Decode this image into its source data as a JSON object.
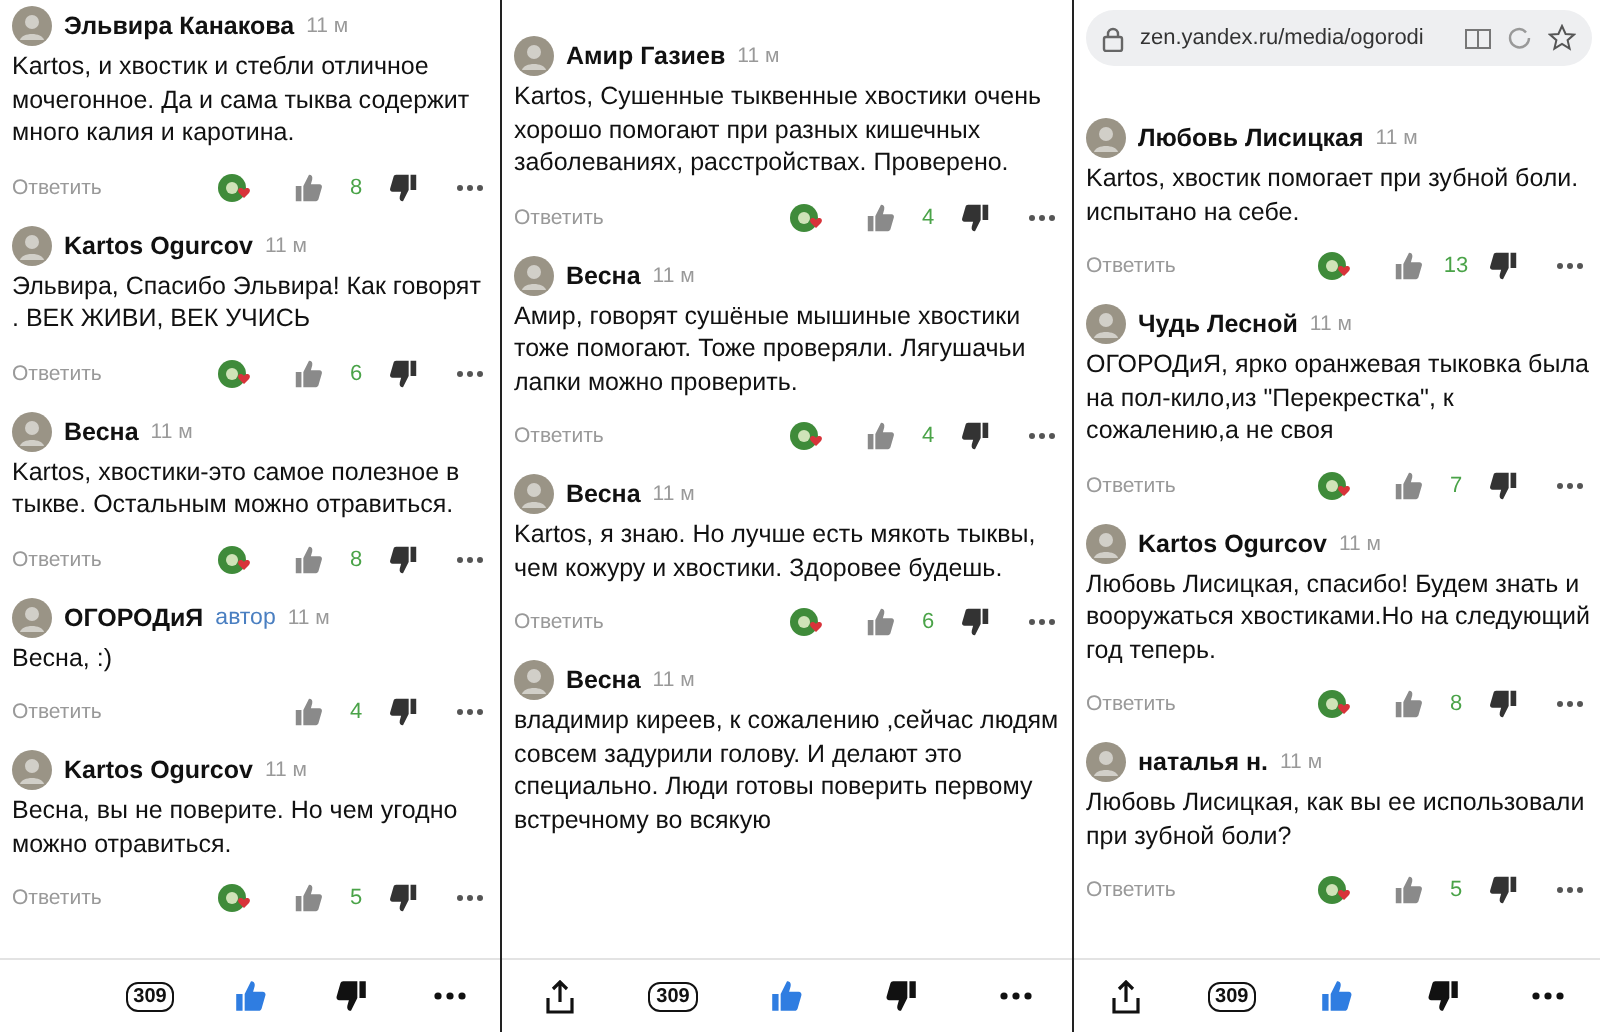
{
  "panels": [
    {
      "comments": [
        {
          "author": "Эльвира Канакова",
          "time": "11 м",
          "text": "Kartos, и хвостик и стебли отличное мочегонное. Да и сама тыква содержит много калия и каротина.",
          "reply": "Ответить",
          "author_liked": true,
          "likes": "8"
        },
        {
          "author": "Kartos Ogurcov",
          "time": "11 м",
          "text": "Эльвира, Спасибо Эльвира! Как говорят . ВЕК ЖИВИ, ВЕК УЧИСЬ",
          "reply": "Ответить",
          "author_liked": true,
          "likes": "6"
        },
        {
          "author": "Весна",
          "time": "11 м",
          "text": "Kartos, хвостики-это самое полезное в тыкве. Остальным можно отравиться.",
          "reply": "Ответить",
          "author_liked": true,
          "likes": "8"
        },
        {
          "author": "ОГОРОДиЯ",
          "badge": "автор",
          "time": "11 м",
          "text": "Весна, :)",
          "reply": "Ответить",
          "author_liked": false,
          "likes": "4"
        },
        {
          "author": "Kartos Ogurcov",
          "time": "11 м",
          "text": "Весна, вы не поверите. Но чем угодно можно отравиться.",
          "reply": "Ответить",
          "author_liked": true,
          "likes": "5"
        }
      ],
      "bottom_bar": {
        "share_button": false,
        "count": "309",
        "liked": true
      }
    },
    {
      "comments": [
        {
          "author": "Амир Газиев",
          "time": "11 м",
          "text": "Kartos, Сушенные тыквенные хвостики очень хорошо помогают при разных кишечных заболеваниях, расстройствах. Проверено.",
          "reply": "Ответить",
          "author_liked": true,
          "likes": "4"
        },
        {
          "author": "Весна",
          "time": "11 м",
          "text": "Амир, говорят сушёные мышиные хвостики тоже помогают. Тоже проверяли. Лягушачьи лапки можно проверить.",
          "reply": "Ответить",
          "author_liked": true,
          "likes": "4"
        },
        {
          "author": "Весна",
          "time": "11 м",
          "text": "Kartos, я знаю. Но лучше есть мякоть тыквы, чем кожуру и хвостики. Здоровее будешь.",
          "reply": "Ответить",
          "author_liked": true,
          "likes": "6"
        },
        {
          "author": "Весна",
          "time": "11 м",
          "text": "владимир киреев, к сожалению ,сейчас людям совсем задурили голову. И делают это специально. Люди готовы поверить первому встречному во всякую"
        }
      ],
      "bottom_bar": {
        "share_button": true,
        "count": "309",
        "liked": true
      }
    },
    {
      "address_bar": {
        "url": "zen.yandex.ru/media/ogorodi"
      },
      "comments": [
        {
          "author": "Любовь Лисицкая",
          "time": "11 м",
          "text": "Kartos, хвостик помогает при зубной боли. испытано на себе.",
          "reply": "Ответить",
          "author_liked": true,
          "likes": "13"
        },
        {
          "author": "Чудь Лесной",
          "time": "11 м",
          "text": "ОГОРОДиЯ, ярко оранжевая тыковка была на пол-кило,из \"Перекрестка\", к сожалению,а не своя",
          "reply": "Ответить",
          "author_liked": true,
          "likes": "7"
        },
        {
          "author": "Kartos Ogurcov",
          "time": "11 м",
          "text": "Любовь Лисицкая, спасибо! Будем знать и вооружаться хвостиками.Но на следующий год теперь.",
          "reply": "Ответить",
          "author_liked": true,
          "likes": "8"
        },
        {
          "author": "наталья н.",
          "time": "11 м",
          "text": "Любовь Лисицкая, как вы ее использовали при зубной боли?",
          "reply": "Ответить",
          "author_liked": true,
          "likes": "5"
        }
      ],
      "bottom_bar": {
        "share_button": true,
        "count": "309",
        "liked": true
      }
    }
  ]
}
